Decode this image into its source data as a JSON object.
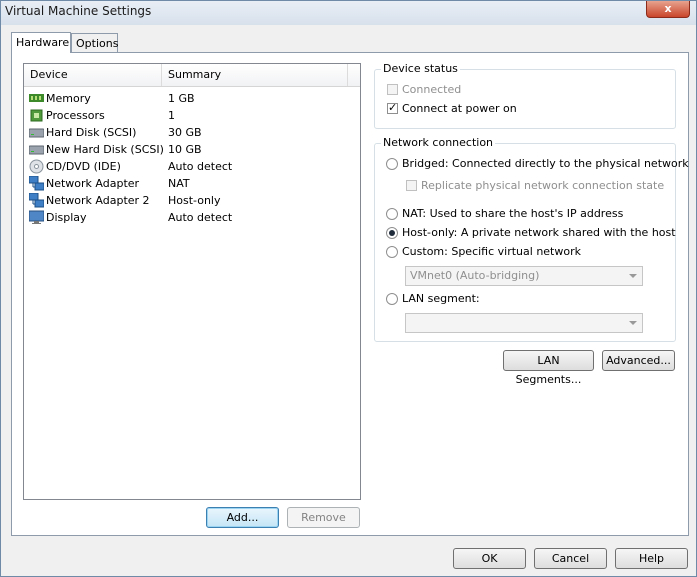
{
  "window": {
    "title": "Virtual Machine Settings",
    "close_label": "x"
  },
  "tabs": [
    {
      "label": "Hardware"
    },
    {
      "label": "Options"
    }
  ],
  "device_list": {
    "headers": {
      "device": "Device",
      "summary": "Summary"
    },
    "rows": [
      {
        "device": "Memory",
        "summary": "1 GB",
        "icon": "memory-icon"
      },
      {
        "device": "Processors",
        "summary": "1",
        "icon": "processor-icon"
      },
      {
        "device": "Hard Disk (SCSI)",
        "summary": "30 GB",
        "icon": "hard-disk-icon"
      },
      {
        "device": "New Hard Disk (SCSI)",
        "summary": "10 GB",
        "icon": "hard-disk-icon"
      },
      {
        "device": "CD/DVD (IDE)",
        "summary": "Auto detect",
        "icon": "cd-dvd-icon"
      },
      {
        "device": "Network Adapter",
        "summary": "NAT",
        "icon": "network-adapter-icon"
      },
      {
        "device": "Network Adapter 2",
        "summary": "Host-only",
        "icon": "network-adapter-icon"
      },
      {
        "device": "Display",
        "summary": "Auto detect",
        "icon": "display-icon"
      }
    ]
  },
  "buttons": {
    "add": "Add...",
    "remove": "Remove",
    "lan_segments": "LAN Segments...",
    "advanced": "Advanced...",
    "ok": "OK",
    "cancel": "Cancel",
    "help": "Help"
  },
  "device_status": {
    "label": "Device status",
    "connected": "Connected",
    "connect_at_power_on": "Connect at power on"
  },
  "network_connection": {
    "label": "Network connection",
    "bridged": "Bridged: Connected directly to the physical network",
    "replicate": "Replicate physical network connection state",
    "nat": "NAT: Used to share the host's IP address",
    "host_only": "Host-only: A private network shared with the host",
    "custom": "Custom: Specific virtual network",
    "custom_value": "VMnet0 (Auto-bridging)",
    "lan_segment": "LAN segment:",
    "lan_segment_value": ""
  }
}
